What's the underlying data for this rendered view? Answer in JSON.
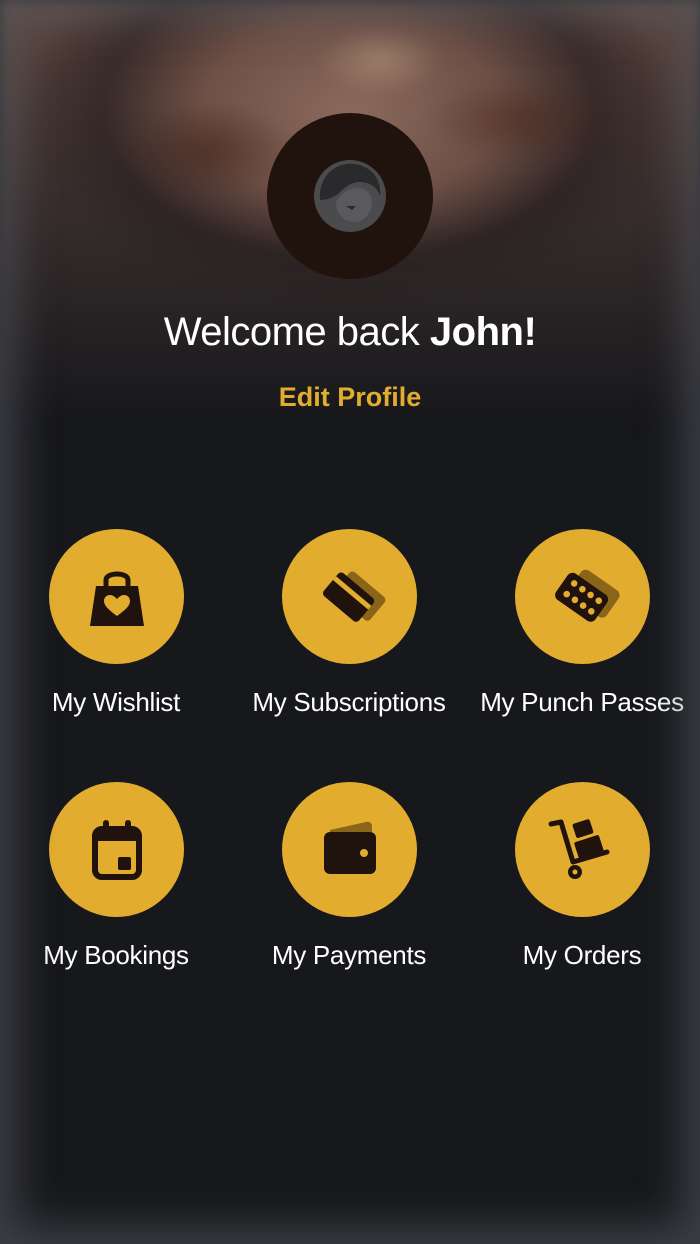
{
  "profile": {
    "greeting": "Welcome back",
    "name": "John!",
    "edit_label": "Edit Profile"
  },
  "menu": [
    {
      "label": "My Wishlist",
      "icon": "shopping-bag-heart-icon"
    },
    {
      "label": "My Subscriptions",
      "icon": "cards-icon"
    },
    {
      "label": "My Punch Passes",
      "icon": "punch-card-icon"
    },
    {
      "label": "My Bookings",
      "icon": "calendar-icon"
    },
    {
      "label": "My Payments",
      "icon": "wallet-icon"
    },
    {
      "label": "My Orders",
      "icon": "hand-truck-icon"
    }
  ],
  "colors": {
    "accent": "#e2ad2f",
    "background": "#17181c",
    "icon_dark": "#20120c"
  }
}
